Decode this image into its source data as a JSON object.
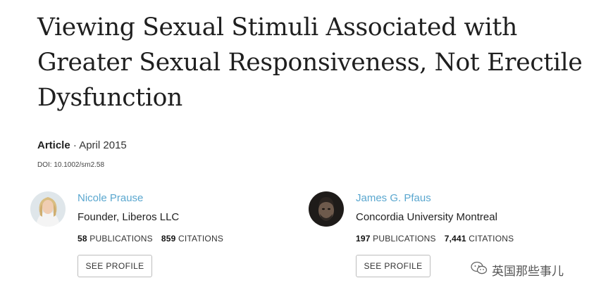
{
  "article": {
    "title": "Viewing Sexual Stimuli Associated with Greater Sexual Responsiveness, Not Erectile Dysfunction",
    "type": "Article",
    "separator": " · ",
    "date": "April 2015",
    "doi": "DOI: 10.1002/sm2.58"
  },
  "authors": [
    {
      "name": "Nicole Prause",
      "affiliation": "Founder, Liberos LLC",
      "publications": "58",
      "publications_label": "PUBLICATIONS",
      "citations": "859",
      "citations_label": "CITATIONS",
      "button_label": "SEE PROFILE"
    },
    {
      "name": "James G. Pfaus",
      "affiliation": "Concordia University Montreal",
      "publications": "197",
      "publications_label": "PUBLICATIONS",
      "citations": "7,441",
      "citations_label": "CITATIONS",
      "button_label": "SEE PROFILE"
    }
  ],
  "watermark": {
    "text": "英国那些事儿",
    "icon": "wechat-icon"
  },
  "colors": {
    "author_link": "#5aa7cf",
    "title": "#1f1f1f",
    "button_border": "#bdbdbd"
  }
}
